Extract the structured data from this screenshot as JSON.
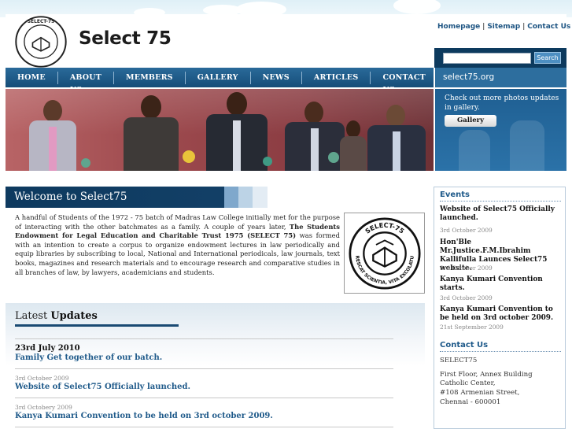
{
  "header": {
    "site_title": "Select 75",
    "toplinks": {
      "homepage": "Homepage",
      "sitemap": "Sitemap",
      "contact": "Contact Us"
    },
    "search_button": "Search",
    "seal_text": "SELECT-75",
    "seal_motto": "CRESCAT SCIENTIA, VITA EXCOLATUR"
  },
  "nav": {
    "items": [
      "HOME",
      "ABOUT US",
      "MEMBERS",
      "GALLERY",
      "NEWS",
      "ARTICLES",
      "CONTACT US"
    ],
    "domain": "select75.org"
  },
  "gallery_panel": {
    "text": "Check out more photos updates in gallery.",
    "button": "Gallery"
  },
  "welcome": {
    "title": "Welcome to Select75",
    "intro_1": "A handful of Students of the 1972 - 75 batch of Madras Law College initially met for the purpose of interacting with the other batchmates as a family. A couple of years later, ",
    "intro_bold": "The Students Endowment for Legal Education and Charitable Trust 1975 (SELECT 75)",
    "intro_2": " was formed with an intention to create a corpus to organize endowment lectures in law periodically and equip libraries by subscribing to local, National and International periodicals, law journals, text books, magazines and research materials and to encourage research and comparative studies in all branches of law, by lawyers, academicians and students."
  },
  "updates": {
    "title_light": "Latest ",
    "title_bold": "Updates",
    "items": [
      {
        "date": "23rd July 2010",
        "title": "Family Get together of our batch."
      },
      {
        "date": "3rd October 2009",
        "title": "Website of Select75 Officially launched."
      },
      {
        "date": "3rd Octobery 2009",
        "title": "Kanya Kumari Convention to be held on 3rd october 2009."
      }
    ]
  },
  "events": {
    "heading": "Events",
    "items": [
      {
        "title": "Website of Select75 Officially launched.",
        "date": "3rd October 2009"
      },
      {
        "title": "Hon'Ble Mr.Justice.F.M.Ibrahim Kallifulla Launces Select75 website.",
        "date": "3rd October 2009"
      },
      {
        "title": "Kanya Kumari Convention starts.",
        "date": "3rd October 2009"
      },
      {
        "title": "Kanya Kumari Convention to be held on 3rd october 2009.",
        "date": "21st September 2009"
      }
    ]
  },
  "contact": {
    "heading": "Contact Us",
    "name": "SELECT75",
    "line1": "First Floor, Annex Building",
    "line2": "Catholic Center,",
    "line3": "#108 Armenian Street,",
    "line4": "Chennai - 600001"
  },
  "colors": {
    "nav": "#1b5581",
    "dark_bar": "#0e3a5f",
    "link": "#1f5a8a"
  }
}
